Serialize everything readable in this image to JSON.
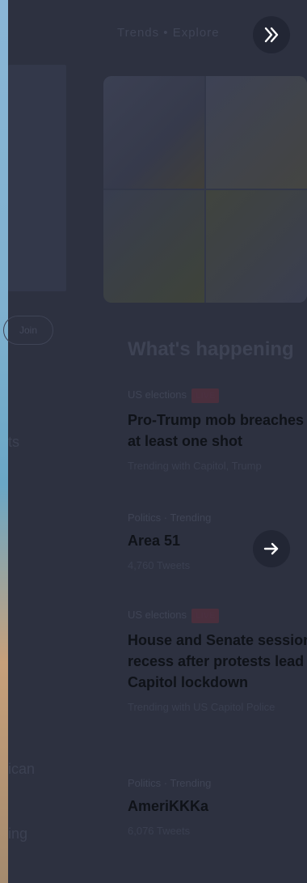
{
  "topbar": {
    "text": "Trends  •  Explore"
  },
  "left": {
    "pill_label": "Join",
    "ghost_1": "ts",
    "ghost_2": "ican",
    "ghost_3": "ing"
  },
  "section": {
    "title": "What's happening"
  },
  "trends": [
    {
      "meta": "US elections",
      "live": "LIVE",
      "headline_lines": [
        "Pro-Trump mob breaches",
        "at least one shot"
      ],
      "sub": "Trending with Capitol, Trump"
    },
    {
      "meta": "Politics · Trending",
      "headline_lines": [
        "Area 51"
      ],
      "sub": "4,760 Tweets"
    },
    {
      "meta": "US elections",
      "live": "LIVE",
      "headline_lines": [
        "House and Senate session",
        "recess after protests lead",
        "Capitol lockdown"
      ],
      "sub": "Trending with US Capitol Police"
    },
    {
      "meta": "Politics · Trending",
      "headline_lines": [
        "AmeriKKKa"
      ],
      "sub": "6,076 Tweets"
    }
  ],
  "icons": {
    "collapse": "double-chevron-right-icon",
    "next": "arrow-right-icon"
  },
  "colors": {
    "overlay": "#2d3140",
    "live": "#4a2f3d"
  }
}
